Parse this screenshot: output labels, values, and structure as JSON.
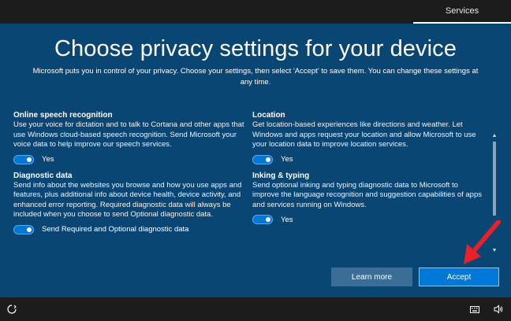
{
  "top_tab": "Services",
  "title": "Choose privacy settings for your device",
  "subtitle": "Microsoft puts you in control of your privacy. Choose your settings, then select 'Accept' to save them. You can change these settings at any time.",
  "settings_left": [
    {
      "title": "Online speech recognition",
      "description": "Use your voice for dictation and to talk to Cortana and other apps that use Windows cloud-based speech recognition. Send Microsoft your voice data to help improve our speech services.",
      "toggle_label": "Yes"
    },
    {
      "title": "Diagnostic data",
      "description": "Send info about the websites you browse and how you use apps and features, plus additional info about device health, device activity, and enhanced error reporting. Required diagnostic data will always be included when you choose to send Optional diagnostic data.",
      "toggle_label": "Send Required and Optional diagnostic data"
    }
  ],
  "settings_right": [
    {
      "title": "Location",
      "description": "Get location-based experiences like directions and weather. Let Windows and apps request your location and allow Microsoft to use your location data to improve location services.",
      "toggle_label": "Yes"
    },
    {
      "title": "Inking & typing",
      "description": "Send optional inking and typing diagnostic data to Microsoft to improve the language recognition and suggestion capabilities of apps and services running on Windows.",
      "toggle_label": "Yes"
    }
  ],
  "buttons": {
    "learn_more": "Learn more",
    "accept": "Accept"
  },
  "icons": {
    "bottom_left": "ease-of-access-icon",
    "keyboard": "keyboard-icon",
    "volume": "volume-icon"
  },
  "colors": {
    "panel": "#0a4674",
    "accent": "#0078d7",
    "arrow": "#e8202a"
  }
}
